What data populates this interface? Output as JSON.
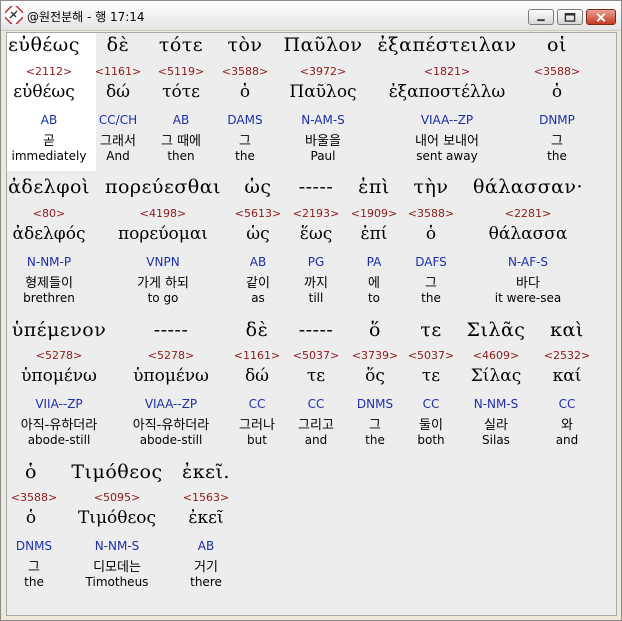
{
  "window": {
    "title": "@원전분해 - 행 17:14"
  },
  "rows": [
    {
      "words": [
        {
          "greek": "εὐθέως",
          "strong": "<2112>",
          "lemma": "εὐθέως",
          "morph": "AB",
          "korean": "곧",
          "english": "immediately"
        },
        {
          "greek": "δὲ",
          "strong": "<1161>",
          "lemma": "δώ",
          "morph": "CC/CH",
          "korean": "그래서",
          "english": "And"
        },
        {
          "greek": "τότε",
          "strong": "<5119>",
          "lemma": "τότε",
          "morph": "AB",
          "korean": "그 때에",
          "english": "then"
        },
        {
          "greek": "τὸν",
          "strong": "<3588>",
          "lemma": "ὁ",
          "morph": "DAMS",
          "korean": "그",
          "english": "the"
        },
        {
          "greek": "Παῦλον",
          "strong": "<3972>",
          "lemma": "Παῦλος",
          "morph": "N-AM-S",
          "korean": "바울을",
          "english": "Paul"
        },
        {
          "greek": "ἐξαπέστειλαν",
          "strong": "<1821>",
          "lemma": "ἐξαποστέλλω",
          "morph": "VIAA--ZP",
          "korean": "내어 보내어",
          "english": "sent away"
        },
        {
          "greek": "οἱ",
          "strong": "<3588>",
          "lemma": "ὁ",
          "morph": "DNMP",
          "korean": "그",
          "english": "the"
        }
      ]
    },
    {
      "words": [
        {
          "greek": "ἀδελφοὶ",
          "strong": "<80>",
          "lemma": "ἀδελφός",
          "morph": "N-NM-P",
          "korean": "형제들이",
          "english": "brethren"
        },
        {
          "greek": "πορεύεσθαι",
          "strong": "<4198>",
          "lemma": "πορεύομαι",
          "morph": "VNPN",
          "korean": "가게 하되",
          "english": "to go"
        },
        {
          "greek": "ὡς",
          "strong": "<5613>",
          "lemma": "ὡς",
          "morph": "AB",
          "korean": "같이",
          "english": "as"
        },
        {
          "greek": "-----",
          "strong": "<2193>",
          "lemma": "ἕως",
          "morph": "PG",
          "korean": "까지",
          "english": "till"
        },
        {
          "greek": "ἐπὶ",
          "strong": "<1909>",
          "lemma": "ἐπί",
          "morph": "PA",
          "korean": "에",
          "english": "to"
        },
        {
          "greek": "τὴν",
          "strong": "<3588>",
          "lemma": "ὁ",
          "morph": "DAFS",
          "korean": "그",
          "english": "the"
        },
        {
          "greek": "θάλασσαν·",
          "strong": "<2281>",
          "lemma": "θάλασσα",
          "morph": "N-AF-S",
          "korean": "바다",
          "english": "it were-sea"
        }
      ]
    },
    {
      "words": [
        {
          "greek": "ὑπέμενον",
          "strong": "<5278>",
          "lemma": "ὑπομένω",
          "morph": "VIIA--ZP",
          "korean": "아직-유하더라",
          "english": "abode-still"
        },
        {
          "greek": "-----",
          "strong": "<5278>",
          "lemma": "ὑπομένω",
          "morph": "VIAA--ZP",
          "korean": "아직-유하더라",
          "english": "abode-still"
        },
        {
          "greek": "δὲ",
          "strong": "<1161>",
          "lemma": "δώ",
          "morph": "CC",
          "korean": "그러나",
          "english": "but"
        },
        {
          "greek": "-----",
          "strong": "<5037>",
          "lemma": "τε",
          "morph": "CC",
          "korean": "그리고",
          "english": "and"
        },
        {
          "greek": "ὅ",
          "strong": "<3739>",
          "lemma": "ὅς",
          "morph": "DNMS",
          "korean": "그",
          "english": "the"
        },
        {
          "greek": "τε",
          "strong": "<5037>",
          "lemma": "τε",
          "morph": "CC",
          "korean": "둘이",
          "english": "both"
        },
        {
          "greek": "Σιλᾶς",
          "strong": "<4609>",
          "lemma": "Σίλας",
          "morph": "N-NM-S",
          "korean": "실라",
          "english": "Silas"
        },
        {
          "greek": "καὶ",
          "strong": "<2532>",
          "lemma": "καί",
          "morph": "CC",
          "korean": "와",
          "english": "and"
        }
      ]
    },
    {
      "words": [
        {
          "greek": "ὁ",
          "strong": "<3588>",
          "lemma": "ὁ",
          "morph": "DNMS",
          "korean": "그",
          "english": "the"
        },
        {
          "greek": "Τιμόθεος",
          "strong": "<5095>",
          "lemma": "Τιμόθεος",
          "morph": "N-NM-S",
          "korean": "디모데는",
          "english": "Timotheus"
        },
        {
          "greek": "ἐκεῖ.",
          "strong": "<1563>",
          "lemma": "ἐκεῖ",
          "morph": "AB",
          "korean": "거기",
          "english": "there"
        }
      ]
    }
  ]
}
